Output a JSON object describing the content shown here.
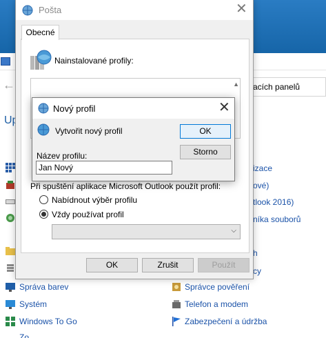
{
  "mail_dialog": {
    "title": "Pošta",
    "close_glyph": "✕",
    "tab_label": "Obecné",
    "installed_profiles_label": "Nainstalované profily:",
    "startup_label": "Při spuštění aplikace Microsoft Outlook použít profil:",
    "radio_prompt_label": "Nabídnout výběr profilu",
    "radio_always_label": "Vždy používat profil",
    "selected_profile": "",
    "ok_label": "OK",
    "cancel_label": "Zrušit",
    "apply_label": "Použít"
  },
  "new_profile_dialog": {
    "title": "Nový profil",
    "close_glyph": "✕",
    "create_label": "Vytvořit nový profil",
    "ok_label": "OK",
    "cancel_label": "Storno",
    "name_label": "Název profilu:",
    "name_value": "Jan Nový"
  },
  "background": {
    "heading_partial": "Up",
    "search_partial": "acích panelů",
    "right_items": [
      "izace",
      "ové)",
      "tlook 2016)",
      "níka souborů",
      "h",
      "cy"
    ],
    "bottom_items": [
      {
        "label": "Správa barev",
        "icon": "color-icon"
      },
      {
        "label": "Systém",
        "icon": "system-icon"
      },
      {
        "label": "Windows To Go",
        "icon": "windows-icon"
      },
      {
        "label": "Správce pověření",
        "icon": "credential-icon"
      },
      {
        "label": "Telefon a modem",
        "icon": "phone-icon"
      },
      {
        "label": "Zabezpečení a údržba",
        "icon": "flag-icon"
      }
    ],
    "cut_item": "Zo"
  },
  "colors": {
    "accent": "#0078d7",
    "link": "#1a52a8",
    "title_bar_bg": "#1665a8"
  }
}
